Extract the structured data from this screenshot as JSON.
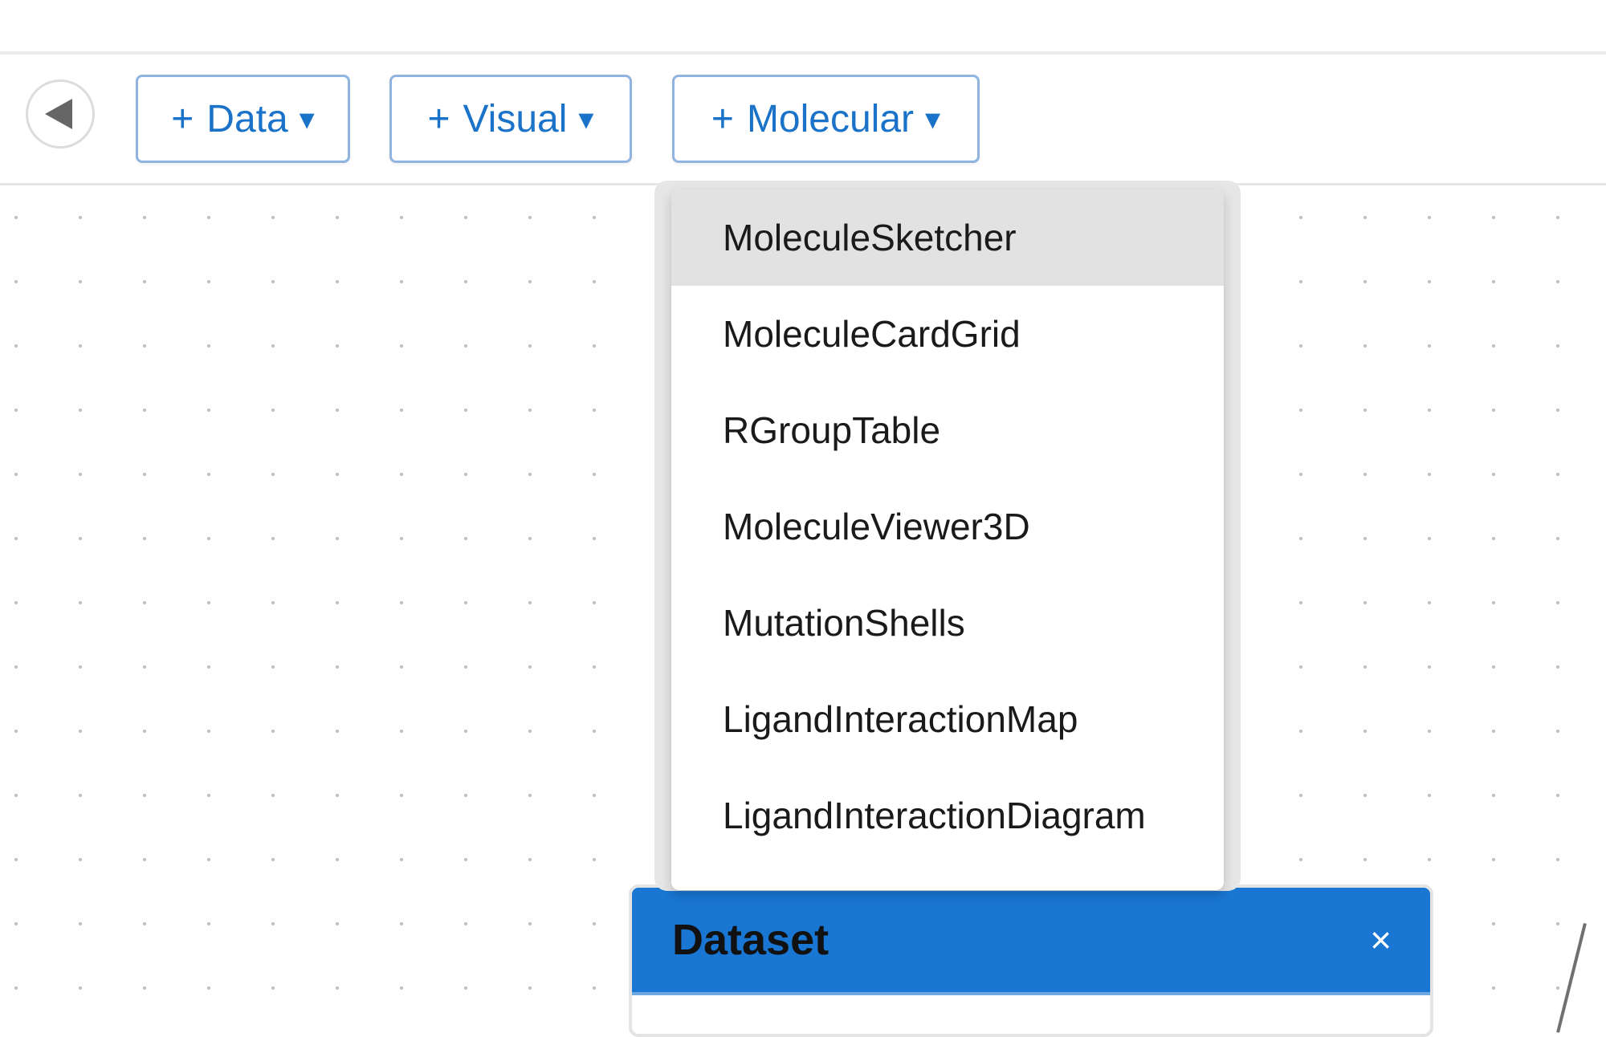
{
  "toolbar": {
    "back_button": {
      "icon": "triangle-left-icon"
    },
    "buttons": [
      {
        "plus": "+",
        "label": "Data",
        "caret": "▾"
      },
      {
        "plus": "+",
        "label": "Visual",
        "caret": "▾"
      },
      {
        "plus": "+",
        "label": "Molecular",
        "caret": "▾"
      }
    ]
  },
  "molecular_menu": {
    "items": [
      {
        "label": "MoleculeSketcher",
        "highlighted": true
      },
      {
        "label": "MoleculeCardGrid",
        "highlighted": false
      },
      {
        "label": "RGroupTable",
        "highlighted": false
      },
      {
        "label": "MoleculeViewer3D",
        "highlighted": false
      },
      {
        "label": "MutationShells",
        "highlighted": false
      },
      {
        "label": "LigandInteractionMap",
        "highlighted": false
      },
      {
        "label": "LigandInteractionDiagram",
        "highlighted": false
      }
    ]
  },
  "node": {
    "title": "Dataset",
    "close": "×"
  },
  "colors": {
    "accent": "#1976d2",
    "button_text": "#1a73c9",
    "button_border": "#8fb4df",
    "highlight": "#e2e2e2"
  }
}
